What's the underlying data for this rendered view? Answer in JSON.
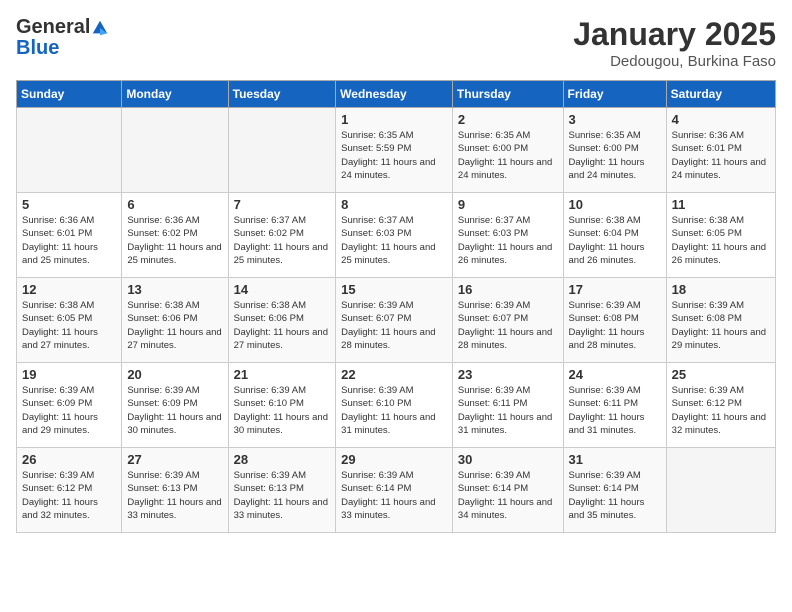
{
  "header": {
    "logo_general": "General",
    "logo_blue": "Blue",
    "month_title": "January 2025",
    "location": "Dedougou, Burkina Faso"
  },
  "days_of_week": [
    "Sunday",
    "Monday",
    "Tuesday",
    "Wednesday",
    "Thursday",
    "Friday",
    "Saturday"
  ],
  "weeks": [
    [
      {
        "day": "",
        "info": ""
      },
      {
        "day": "",
        "info": ""
      },
      {
        "day": "",
        "info": ""
      },
      {
        "day": "1",
        "info": "Sunrise: 6:35 AM\nSunset: 5:59 PM\nDaylight: 11 hours and 24 minutes."
      },
      {
        "day": "2",
        "info": "Sunrise: 6:35 AM\nSunset: 6:00 PM\nDaylight: 11 hours and 24 minutes."
      },
      {
        "day": "3",
        "info": "Sunrise: 6:35 AM\nSunset: 6:00 PM\nDaylight: 11 hours and 24 minutes."
      },
      {
        "day": "4",
        "info": "Sunrise: 6:36 AM\nSunset: 6:01 PM\nDaylight: 11 hours and 24 minutes."
      }
    ],
    [
      {
        "day": "5",
        "info": "Sunrise: 6:36 AM\nSunset: 6:01 PM\nDaylight: 11 hours and 25 minutes."
      },
      {
        "day": "6",
        "info": "Sunrise: 6:36 AM\nSunset: 6:02 PM\nDaylight: 11 hours and 25 minutes."
      },
      {
        "day": "7",
        "info": "Sunrise: 6:37 AM\nSunset: 6:02 PM\nDaylight: 11 hours and 25 minutes."
      },
      {
        "day": "8",
        "info": "Sunrise: 6:37 AM\nSunset: 6:03 PM\nDaylight: 11 hours and 25 minutes."
      },
      {
        "day": "9",
        "info": "Sunrise: 6:37 AM\nSunset: 6:03 PM\nDaylight: 11 hours and 26 minutes."
      },
      {
        "day": "10",
        "info": "Sunrise: 6:38 AM\nSunset: 6:04 PM\nDaylight: 11 hours and 26 minutes."
      },
      {
        "day": "11",
        "info": "Sunrise: 6:38 AM\nSunset: 6:05 PM\nDaylight: 11 hours and 26 minutes."
      }
    ],
    [
      {
        "day": "12",
        "info": "Sunrise: 6:38 AM\nSunset: 6:05 PM\nDaylight: 11 hours and 27 minutes."
      },
      {
        "day": "13",
        "info": "Sunrise: 6:38 AM\nSunset: 6:06 PM\nDaylight: 11 hours and 27 minutes."
      },
      {
        "day": "14",
        "info": "Sunrise: 6:38 AM\nSunset: 6:06 PM\nDaylight: 11 hours and 27 minutes."
      },
      {
        "day": "15",
        "info": "Sunrise: 6:39 AM\nSunset: 6:07 PM\nDaylight: 11 hours and 28 minutes."
      },
      {
        "day": "16",
        "info": "Sunrise: 6:39 AM\nSunset: 6:07 PM\nDaylight: 11 hours and 28 minutes."
      },
      {
        "day": "17",
        "info": "Sunrise: 6:39 AM\nSunset: 6:08 PM\nDaylight: 11 hours and 28 minutes."
      },
      {
        "day": "18",
        "info": "Sunrise: 6:39 AM\nSunset: 6:08 PM\nDaylight: 11 hours and 29 minutes."
      }
    ],
    [
      {
        "day": "19",
        "info": "Sunrise: 6:39 AM\nSunset: 6:09 PM\nDaylight: 11 hours and 29 minutes."
      },
      {
        "day": "20",
        "info": "Sunrise: 6:39 AM\nSunset: 6:09 PM\nDaylight: 11 hours and 30 minutes."
      },
      {
        "day": "21",
        "info": "Sunrise: 6:39 AM\nSunset: 6:10 PM\nDaylight: 11 hours and 30 minutes."
      },
      {
        "day": "22",
        "info": "Sunrise: 6:39 AM\nSunset: 6:10 PM\nDaylight: 11 hours and 31 minutes."
      },
      {
        "day": "23",
        "info": "Sunrise: 6:39 AM\nSunset: 6:11 PM\nDaylight: 11 hours and 31 minutes."
      },
      {
        "day": "24",
        "info": "Sunrise: 6:39 AM\nSunset: 6:11 PM\nDaylight: 11 hours and 31 minutes."
      },
      {
        "day": "25",
        "info": "Sunrise: 6:39 AM\nSunset: 6:12 PM\nDaylight: 11 hours and 32 minutes."
      }
    ],
    [
      {
        "day": "26",
        "info": "Sunrise: 6:39 AM\nSunset: 6:12 PM\nDaylight: 11 hours and 32 minutes."
      },
      {
        "day": "27",
        "info": "Sunrise: 6:39 AM\nSunset: 6:13 PM\nDaylight: 11 hours and 33 minutes."
      },
      {
        "day": "28",
        "info": "Sunrise: 6:39 AM\nSunset: 6:13 PM\nDaylight: 11 hours and 33 minutes."
      },
      {
        "day": "29",
        "info": "Sunrise: 6:39 AM\nSunset: 6:14 PM\nDaylight: 11 hours and 33 minutes."
      },
      {
        "day": "30",
        "info": "Sunrise: 6:39 AM\nSunset: 6:14 PM\nDaylight: 11 hours and 34 minutes."
      },
      {
        "day": "31",
        "info": "Sunrise: 6:39 AM\nSunset: 6:14 PM\nDaylight: 11 hours and 35 minutes."
      },
      {
        "day": "",
        "info": ""
      }
    ]
  ]
}
